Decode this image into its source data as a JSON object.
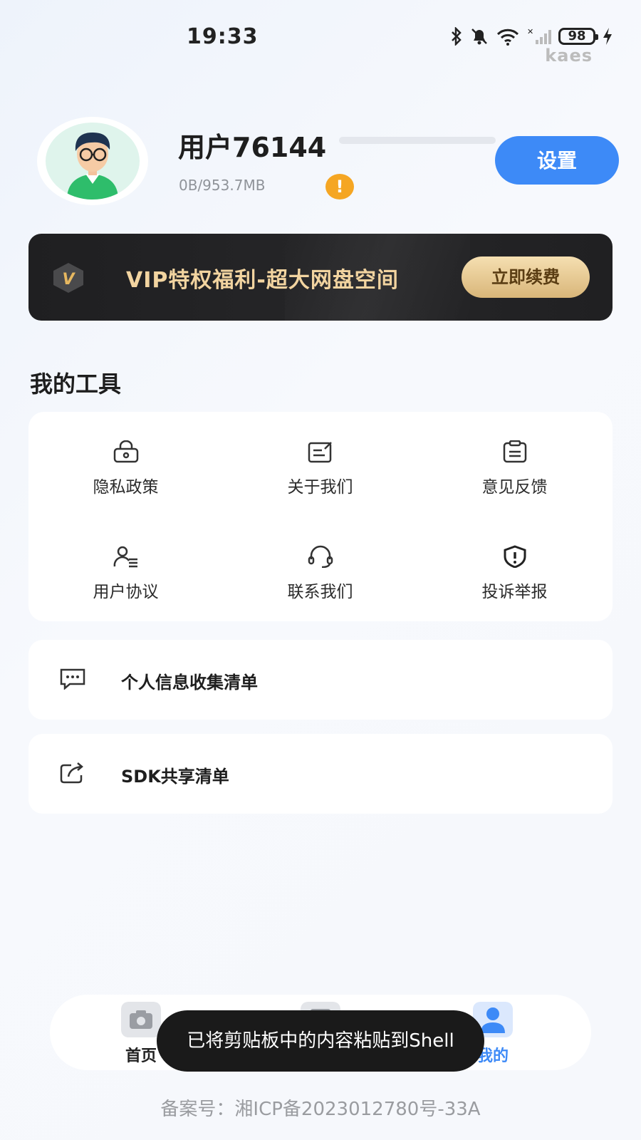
{
  "status_bar": {
    "time": "19:33",
    "battery": "98",
    "carrier_watermark": "kaes",
    "icons": [
      "bluetooth-icon",
      "mute-bell-icon",
      "wifi-icon",
      "signal-icon",
      "battery-icon",
      "charging-icon"
    ]
  },
  "profile": {
    "username": "用户76144",
    "storage": "0B/953.7MB",
    "storage_used_fraction": 0,
    "warning_glyph": "!",
    "settings_label": "设置"
  },
  "vip": {
    "badge": "V",
    "text": "VIP特权福利-超大网盘空间",
    "renew_label": "立即续费"
  },
  "tools": {
    "title": "我的工具",
    "items": [
      {
        "label": "隐私政策",
        "icon": "lock-bag-icon"
      },
      {
        "label": "关于我们",
        "icon": "edit-doc-icon"
      },
      {
        "label": "意见反馈",
        "icon": "clipboard-icon"
      },
      {
        "label": "用户协议",
        "icon": "user-list-icon"
      },
      {
        "label": "联系我们",
        "icon": "headset-icon"
      },
      {
        "label": "投诉举报",
        "icon": "shield-alert-icon"
      }
    ]
  },
  "lists": [
    {
      "label": "个人信息收集清单",
      "icon": "message-dots-icon"
    },
    {
      "label": "SDK共享清单",
      "icon": "share-icon"
    }
  ],
  "nav": {
    "items": [
      {
        "label": "首页",
        "icon": "camera-icon"
      },
      {
        "label": "",
        "icon": "doc-icon"
      },
      {
        "label": "我的",
        "icon": "person-icon"
      }
    ],
    "active_color": "#3d8af7"
  },
  "toast": "已将剪贴板中的内容粘贴到Shell",
  "footer": "备案号：湘ICP备2023012780号-33A"
}
